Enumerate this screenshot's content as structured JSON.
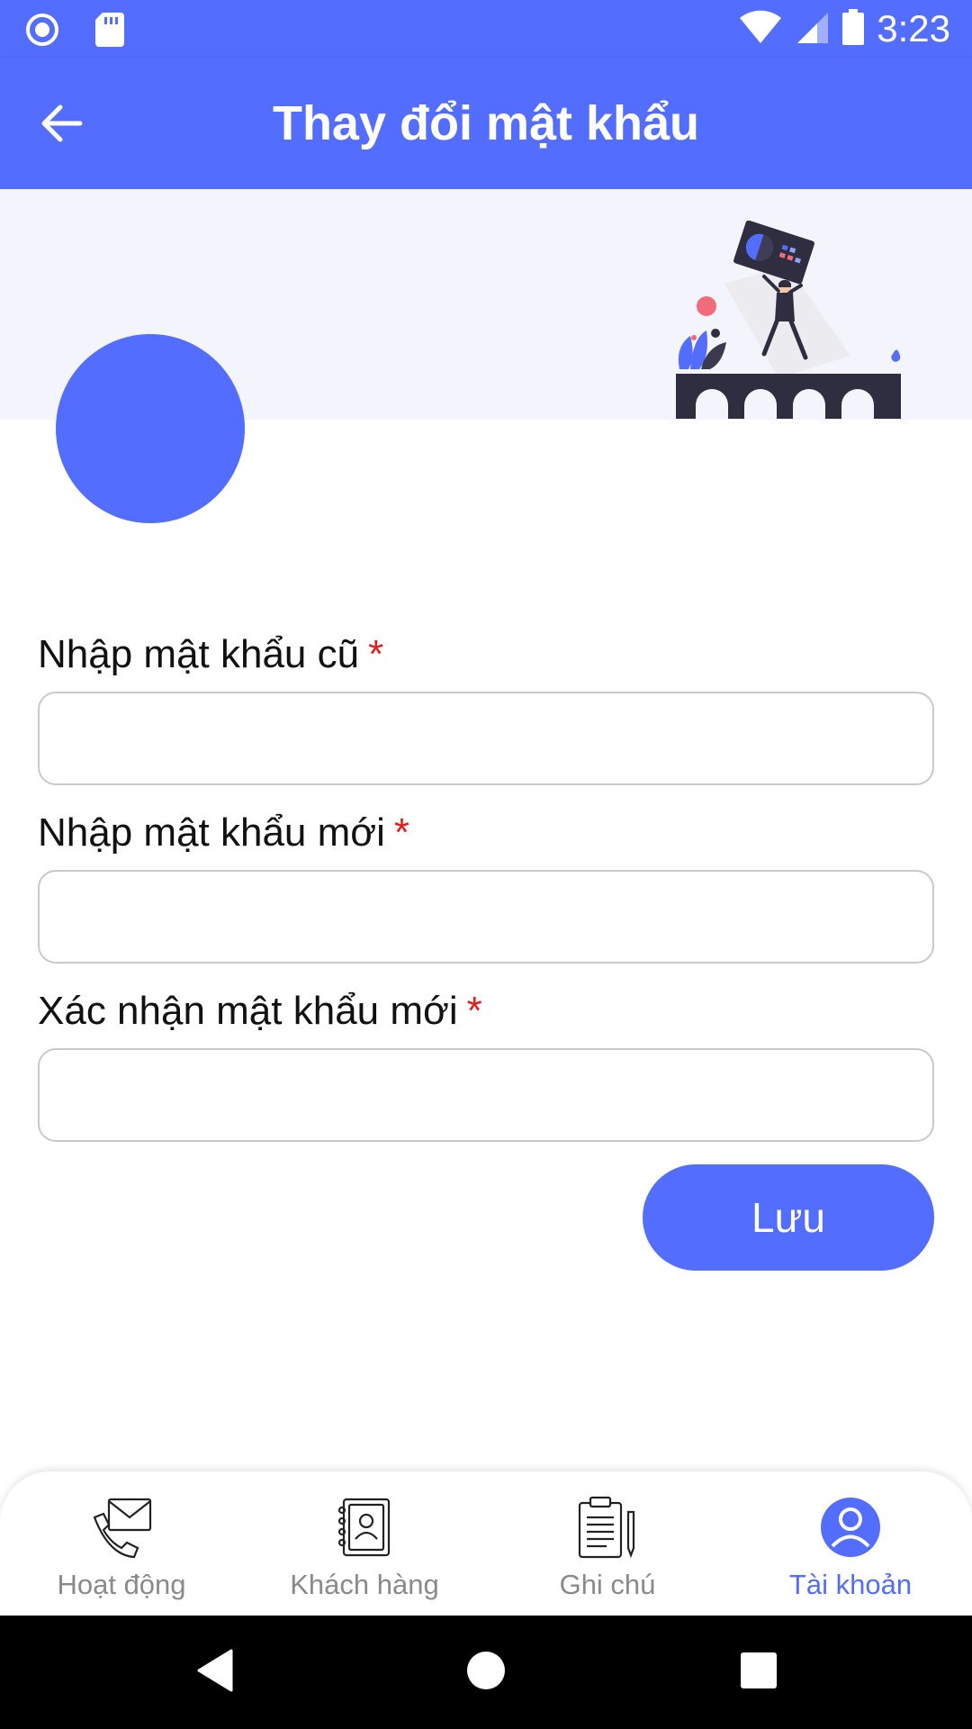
{
  "status_bar": {
    "time": "3:23",
    "icons": [
      "record-icon",
      "sd-card-icon",
      "wifi-icon",
      "signal-icon",
      "battery-icon"
    ]
  },
  "app_bar": {
    "title": "Thay đổi mật khẩu",
    "back_icon": "arrow-left-icon"
  },
  "form": {
    "old_password": {
      "label": "Nhập mật khẩu cũ",
      "required_mark": "*",
      "value": ""
    },
    "new_password": {
      "label": "Nhập mật khẩu mới",
      "required_mark": "*",
      "value": ""
    },
    "confirm_password": {
      "label": "Xác nhận mật khẩu mới",
      "required_mark": "*",
      "value": ""
    },
    "save_label": "Lưu"
  },
  "bottom_nav": {
    "items": [
      {
        "label": "Hoạt động",
        "icon": "phone-mail-icon",
        "active": false
      },
      {
        "label": "Khách hàng",
        "icon": "contact-book-icon",
        "active": false
      },
      {
        "label": "Ghi chú",
        "icon": "clipboard-note-icon",
        "active": false
      },
      {
        "label": "Tài khoản",
        "icon": "user-account-icon",
        "active": true
      }
    ]
  },
  "colors": {
    "primary": "#536dfe",
    "required": "#e02020",
    "banner_bg": "#f3f4fc"
  }
}
